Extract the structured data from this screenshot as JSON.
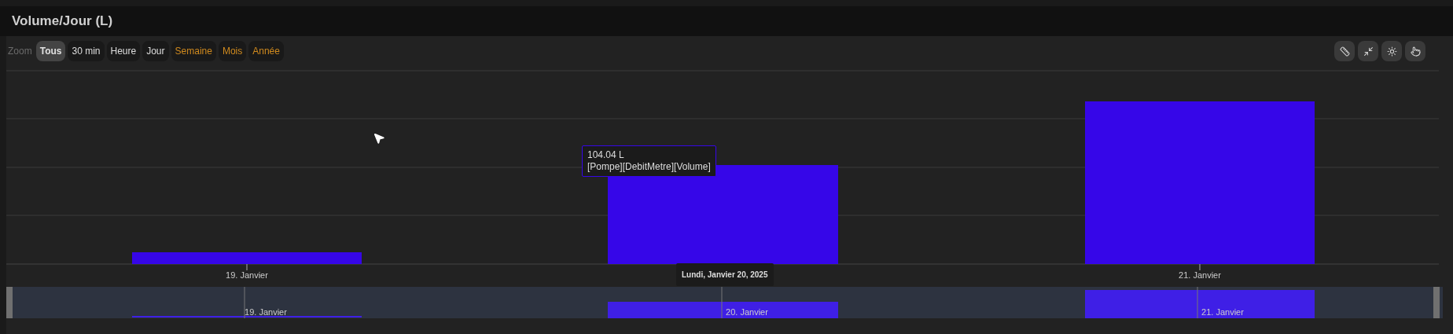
{
  "header": {
    "title": "Volume/Jour (L)"
  },
  "zoom": {
    "label": "Zoom",
    "buttons": [
      {
        "label": "Tous",
        "selected": true,
        "accent": false
      },
      {
        "label": "30 min",
        "selected": false,
        "accent": false
      },
      {
        "label": "Heure",
        "selected": false,
        "accent": false
      },
      {
        "label": "Jour",
        "selected": false,
        "accent": false
      },
      {
        "label": "Semaine",
        "selected": false,
        "accent": true
      },
      {
        "label": "Mois",
        "selected": false,
        "accent": true
      },
      {
        "label": "Année",
        "selected": false,
        "accent": true
      }
    ]
  },
  "chart": {
    "x_labels": [
      "19. Janvier",
      "21. Janvier"
    ],
    "navigator_labels": [
      "19. Janvier",
      "20. Janvier",
      "21. Janvier"
    ]
  },
  "tooltip": {
    "value": "104.04 L",
    "series": "[Pompe][DebitMetre][Volume]"
  },
  "crosshair_label": "Lundi, Janvier 20, 2025"
}
